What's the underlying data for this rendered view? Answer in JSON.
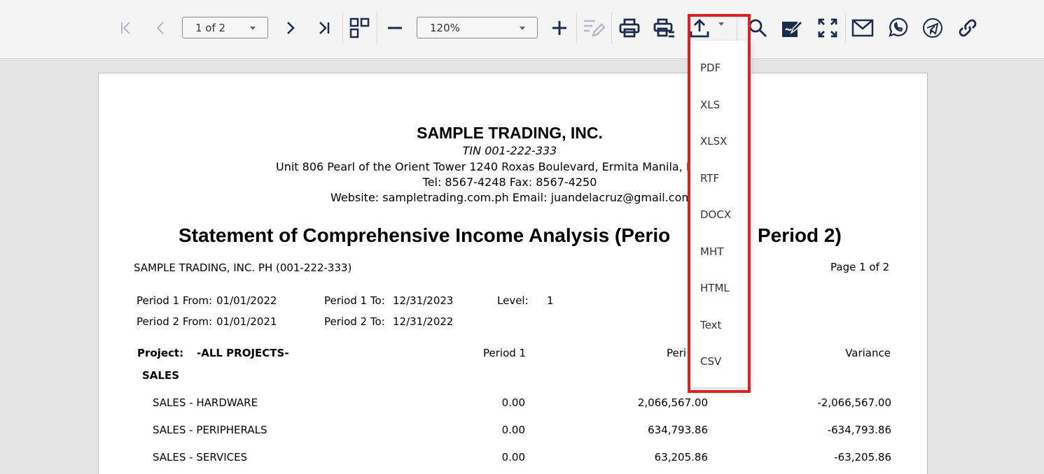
{
  "toolbar": {
    "page_selector": "1 of 2",
    "zoom": "120%",
    "icons": [
      "first-page-icon",
      "previous-page-icon",
      "next-page-icon",
      "last-page-icon",
      "multi-page-icon",
      "zoom-out-icon",
      "zoom-in-icon",
      "edit-icon",
      "print-icon",
      "print-settings-icon",
      "export-icon",
      "search-icon",
      "sign-icon",
      "fullscreen-icon",
      "email-icon",
      "whatsapp-icon",
      "telegram-icon",
      "link-icon"
    ]
  },
  "export_menu": {
    "items": [
      "PDF",
      "XLS",
      "XLSX",
      "RTF",
      "DOCX",
      "MHT",
      "HTML",
      "Text",
      "CSV"
    ],
    "highlight_color": "#e0201e"
  },
  "report": {
    "company_name": "SAMPLE TRADING, INC.",
    "tin": "TIN 001-222-333",
    "address": "Unit 806 Pearl of the Orient Tower 1240 Roxas Boulevard, Ermita Manila, P",
    "phone": "Tel: 8567-4248  Fax: 8567-4250",
    "web": "Website: sampletrading.com.ph  Email: juandelacruz@gmail.com",
    "title_left": "Statement of Comprehensive Income Analysis (Perio",
    "title_right": "Period 2)",
    "entity": "SAMPLE TRADING, INC. PH (001-222-333)",
    "page_info": "Page 1 of 2",
    "params": {
      "p1_from_label": "Period 1 From:",
      "p1_from": "01/01/2022",
      "p1_to_label": "Period 1 To:",
      "p1_to": "12/31/2023",
      "level_label": "Level:",
      "level": "1",
      "p2_from_label": "Period 2 From:",
      "p2_from": "01/01/2021",
      "p2_to_label": "Period 2 To:",
      "p2_to": "12/31/2022"
    },
    "project_label": "Project:",
    "project_value": "-ALL PROJECTS-",
    "columns": [
      "Period 1",
      "Peri",
      "Variance"
    ],
    "section": "SALES",
    "rows": [
      {
        "name": "SALES - HARDWARE",
        "p1": "0.00",
        "p2": "2,066,567.00",
        "var": "-2,066,567.00"
      },
      {
        "name": "SALES - PERIPHERALS",
        "p1": "0.00",
        "p2": "634,793.86",
        "var": "-634,793.86"
      },
      {
        "name": "SALES - SERVICES",
        "p1": "0.00",
        "p2": "63,205.86",
        "var": "-63,205.86"
      }
    ]
  }
}
